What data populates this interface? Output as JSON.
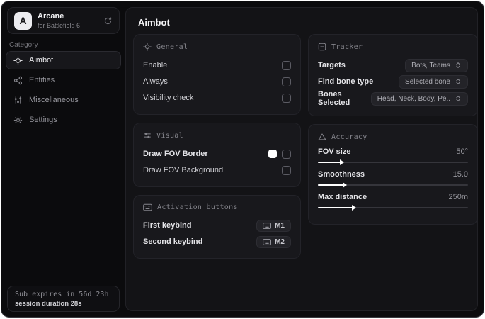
{
  "app": {
    "background": "#0b0b0d",
    "accent": "#ffffff"
  },
  "sidebar": {
    "brand": {
      "initial": "A",
      "title": "Arcane",
      "subtitle": "for Battlefield 6",
      "action_icon": "refresh-icon"
    },
    "category_label": "Category",
    "items": [
      {
        "label": "Aimbot",
        "icon": "crosshair-icon",
        "active": true
      },
      {
        "label": "Entities",
        "icon": "entities-icon",
        "active": false
      },
      {
        "label": "Miscellaneous",
        "icon": "sliders-icon",
        "active": false
      },
      {
        "label": "Settings",
        "icon": "gear-icon",
        "active": false
      }
    ],
    "footer": {
      "expiry": "Sub expires in 56d 23h",
      "session": "session duration 28s"
    }
  },
  "main": {
    "title": "Aimbot",
    "general": {
      "icon": "target-icon",
      "title": "General",
      "rows": [
        {
          "label": "Enable",
          "checked": false
        },
        {
          "label": "Always",
          "checked": false
        },
        {
          "label": "Visibility check",
          "checked": false
        }
      ]
    },
    "visual": {
      "icon": "adjust-icon",
      "title": "Visual",
      "rows": [
        {
          "label": "Draw FOV Border",
          "swatch": "#ffffff",
          "checked": false
        },
        {
          "label": "Draw FOV Background",
          "checked": false
        }
      ]
    },
    "activation": {
      "icon": "keyboard-icon",
      "title": "Activation buttons",
      "rows": [
        {
          "label": "First keybind",
          "key": "M1"
        },
        {
          "label": "Second keybind",
          "key": "M2"
        }
      ]
    },
    "tracker": {
      "icon": "scan-box-icon",
      "title": "Tracker",
      "rows": [
        {
          "label": "Targets",
          "value": "Bots, Teams"
        },
        {
          "label": "Find bone type",
          "value": "Selected bone"
        },
        {
          "label": "Bones Selected",
          "value": "Head, Neck, Body, Pe.."
        }
      ]
    },
    "accuracy": {
      "icon": "triangle-icon",
      "title": "Accuracy",
      "rows": [
        {
          "label": "FOV size",
          "value": "50°",
          "fill_pct": 15
        },
        {
          "label": "Smoothness",
          "value": "15.0",
          "fill_pct": 17
        },
        {
          "label": "Max distance",
          "value": "250m",
          "fill_pct": 23
        }
      ]
    }
  }
}
